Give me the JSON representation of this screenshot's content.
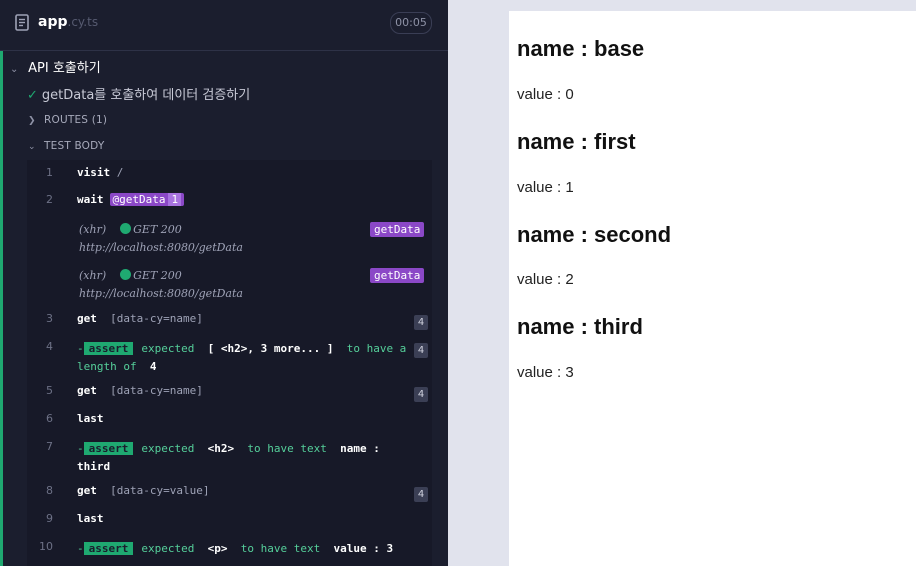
{
  "header": {
    "spec_name": "app",
    "spec_ext": ".cy.ts",
    "duration": "00:05"
  },
  "suite": {
    "title": "API 호출하기",
    "test": {
      "title": "getData를 호출하여 데이터 검증하기",
      "status": "passed"
    },
    "routes_label": "ROUTES (1)",
    "test_body_label": "TEST BODY"
  },
  "commands": [
    {
      "num": "1",
      "name": "visit",
      "arg": "/"
    },
    {
      "num": "2",
      "name": "wait",
      "alias": "@getData",
      "alias_count": "1"
    },
    {
      "type": "xhr",
      "method": "(xhr)",
      "request": "GET 200",
      "url": "http://localhost:8080/getData",
      "alias": "getData"
    },
    {
      "type": "xhr",
      "method": "(xhr)",
      "request": "GET 200",
      "url": "http://localhost:8080/getData",
      "alias": "getData"
    },
    {
      "num": "3",
      "name": "get",
      "arg": "[data-cy=name]",
      "count": "4"
    },
    {
      "num": "4",
      "assert": "assert",
      "parts": [
        "expected",
        "[ <h2>, 3 more... ]",
        "to have a length of",
        "4"
      ],
      "count": "4"
    },
    {
      "num": "5",
      "name": "get",
      "arg": "[data-cy=name]",
      "count": "4"
    },
    {
      "num": "6",
      "name": "last"
    },
    {
      "num": "7",
      "assert": "assert",
      "parts": [
        "expected",
        "<h2>",
        "to have text",
        "name : third"
      ]
    },
    {
      "num": "8",
      "name": "get",
      "arg": "[data-cy=value]",
      "count": "4"
    },
    {
      "num": "9",
      "name": "last"
    },
    {
      "num": "10",
      "assert": "assert",
      "parts": [
        "expected",
        "<p>",
        "to have text",
        "value : 3"
      ]
    }
  ],
  "preview": {
    "items": [
      {
        "name": "name : base",
        "value": "value : 0"
      },
      {
        "name": "name : first",
        "value": "value : 1"
      },
      {
        "name": "name : second",
        "value": "value : 2"
      },
      {
        "name": "name : third",
        "value": "value : 3"
      }
    ]
  },
  "colors": {
    "panel_bg": "#1b1e2e",
    "pass_green": "#1fa971",
    "alias_purple": "#8b48c7",
    "preview_bg": "#ffffff"
  },
  "icons": [
    "file-icon",
    "check-icon",
    "chevron-down-icon",
    "chevron-right-icon",
    "status-dot-icon"
  ]
}
